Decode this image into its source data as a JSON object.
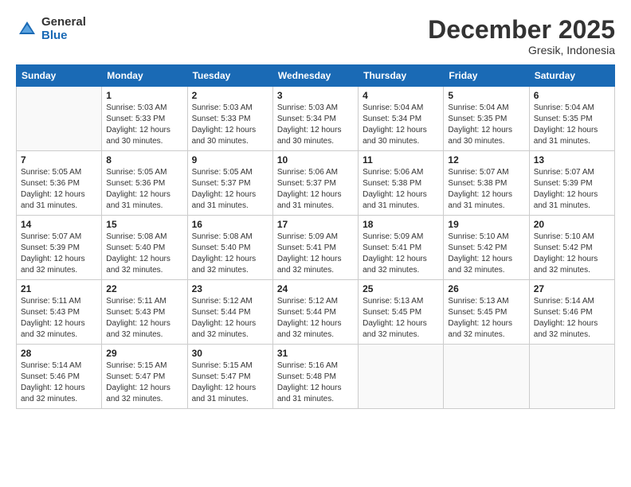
{
  "header": {
    "logo_general": "General",
    "logo_blue": "Blue",
    "month_title": "December 2025",
    "location": "Gresik, Indonesia"
  },
  "columns": [
    "Sunday",
    "Monday",
    "Tuesday",
    "Wednesday",
    "Thursday",
    "Friday",
    "Saturday"
  ],
  "weeks": [
    [
      {
        "day": "",
        "info": ""
      },
      {
        "day": "1",
        "info": "Sunrise: 5:03 AM\nSunset: 5:33 PM\nDaylight: 12 hours\nand 30 minutes."
      },
      {
        "day": "2",
        "info": "Sunrise: 5:03 AM\nSunset: 5:33 PM\nDaylight: 12 hours\nand 30 minutes."
      },
      {
        "day": "3",
        "info": "Sunrise: 5:03 AM\nSunset: 5:34 PM\nDaylight: 12 hours\nand 30 minutes."
      },
      {
        "day": "4",
        "info": "Sunrise: 5:04 AM\nSunset: 5:34 PM\nDaylight: 12 hours\nand 30 minutes."
      },
      {
        "day": "5",
        "info": "Sunrise: 5:04 AM\nSunset: 5:35 PM\nDaylight: 12 hours\nand 30 minutes."
      },
      {
        "day": "6",
        "info": "Sunrise: 5:04 AM\nSunset: 5:35 PM\nDaylight: 12 hours\nand 31 minutes."
      }
    ],
    [
      {
        "day": "7",
        "info": "Sunrise: 5:05 AM\nSunset: 5:36 PM\nDaylight: 12 hours\nand 31 minutes."
      },
      {
        "day": "8",
        "info": "Sunrise: 5:05 AM\nSunset: 5:36 PM\nDaylight: 12 hours\nand 31 minutes."
      },
      {
        "day": "9",
        "info": "Sunrise: 5:05 AM\nSunset: 5:37 PM\nDaylight: 12 hours\nand 31 minutes."
      },
      {
        "day": "10",
        "info": "Sunrise: 5:06 AM\nSunset: 5:37 PM\nDaylight: 12 hours\nand 31 minutes."
      },
      {
        "day": "11",
        "info": "Sunrise: 5:06 AM\nSunset: 5:38 PM\nDaylight: 12 hours\nand 31 minutes."
      },
      {
        "day": "12",
        "info": "Sunrise: 5:07 AM\nSunset: 5:38 PM\nDaylight: 12 hours\nand 31 minutes."
      },
      {
        "day": "13",
        "info": "Sunrise: 5:07 AM\nSunset: 5:39 PM\nDaylight: 12 hours\nand 31 minutes."
      }
    ],
    [
      {
        "day": "14",
        "info": "Sunrise: 5:07 AM\nSunset: 5:39 PM\nDaylight: 12 hours\nand 32 minutes."
      },
      {
        "day": "15",
        "info": "Sunrise: 5:08 AM\nSunset: 5:40 PM\nDaylight: 12 hours\nand 32 minutes."
      },
      {
        "day": "16",
        "info": "Sunrise: 5:08 AM\nSunset: 5:40 PM\nDaylight: 12 hours\nand 32 minutes."
      },
      {
        "day": "17",
        "info": "Sunrise: 5:09 AM\nSunset: 5:41 PM\nDaylight: 12 hours\nand 32 minutes."
      },
      {
        "day": "18",
        "info": "Sunrise: 5:09 AM\nSunset: 5:41 PM\nDaylight: 12 hours\nand 32 minutes."
      },
      {
        "day": "19",
        "info": "Sunrise: 5:10 AM\nSunset: 5:42 PM\nDaylight: 12 hours\nand 32 minutes."
      },
      {
        "day": "20",
        "info": "Sunrise: 5:10 AM\nSunset: 5:42 PM\nDaylight: 12 hours\nand 32 minutes."
      }
    ],
    [
      {
        "day": "21",
        "info": "Sunrise: 5:11 AM\nSunset: 5:43 PM\nDaylight: 12 hours\nand 32 minutes."
      },
      {
        "day": "22",
        "info": "Sunrise: 5:11 AM\nSunset: 5:43 PM\nDaylight: 12 hours\nand 32 minutes."
      },
      {
        "day": "23",
        "info": "Sunrise: 5:12 AM\nSunset: 5:44 PM\nDaylight: 12 hours\nand 32 minutes."
      },
      {
        "day": "24",
        "info": "Sunrise: 5:12 AM\nSunset: 5:44 PM\nDaylight: 12 hours\nand 32 minutes."
      },
      {
        "day": "25",
        "info": "Sunrise: 5:13 AM\nSunset: 5:45 PM\nDaylight: 12 hours\nand 32 minutes."
      },
      {
        "day": "26",
        "info": "Sunrise: 5:13 AM\nSunset: 5:45 PM\nDaylight: 12 hours\nand 32 minutes."
      },
      {
        "day": "27",
        "info": "Sunrise: 5:14 AM\nSunset: 5:46 PM\nDaylight: 12 hours\nand 32 minutes."
      }
    ],
    [
      {
        "day": "28",
        "info": "Sunrise: 5:14 AM\nSunset: 5:46 PM\nDaylight: 12 hours\nand 32 minutes."
      },
      {
        "day": "29",
        "info": "Sunrise: 5:15 AM\nSunset: 5:47 PM\nDaylight: 12 hours\nand 32 minutes."
      },
      {
        "day": "30",
        "info": "Sunrise: 5:15 AM\nSunset: 5:47 PM\nDaylight: 12 hours\nand 31 minutes."
      },
      {
        "day": "31",
        "info": "Sunrise: 5:16 AM\nSunset: 5:48 PM\nDaylight: 12 hours\nand 31 minutes."
      },
      {
        "day": "",
        "info": ""
      },
      {
        "day": "",
        "info": ""
      },
      {
        "day": "",
        "info": ""
      }
    ]
  ]
}
